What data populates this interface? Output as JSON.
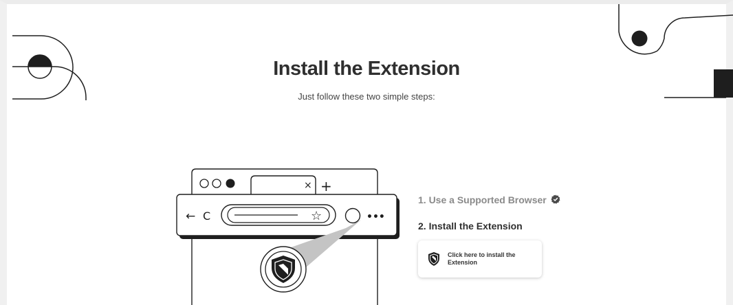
{
  "header": {
    "title": "Install the Extension",
    "subtitle": "Just follow these two simple steps:"
  },
  "steps": {
    "step1": "1. Use a Supported Browser",
    "step2": "2. Install the Extension"
  },
  "install_button": {
    "label": "Click here to install the Extension"
  },
  "browser_illustration": {
    "tab_close": "×",
    "new_tab": "+",
    "back": "←",
    "reload": "C",
    "star": "☆",
    "menu": "•••"
  },
  "colors": {
    "ink": "#1e1e1e",
    "step_done": "#8a8a8a",
    "frame": "#f0f0f0"
  }
}
